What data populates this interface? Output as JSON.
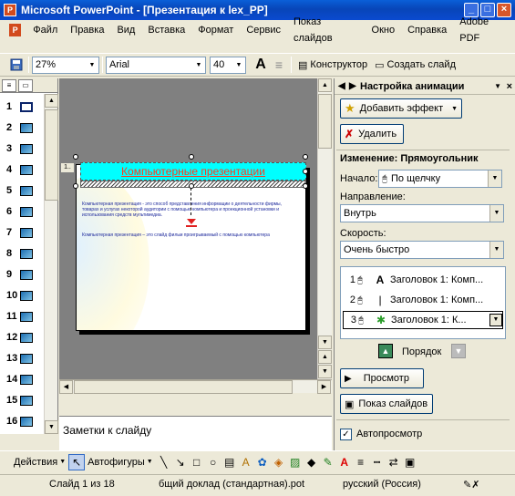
{
  "window": {
    "title": "Microsoft PowerPoint - [Презентация к lex_PP]",
    "app_icon": "powerpoint-icon",
    "controls": [
      "_",
      "□",
      "×"
    ]
  },
  "menubar": {
    "items": [
      "Файл",
      "Правка",
      "Вид",
      "Вставка",
      "Формат",
      "Сервис",
      "Показ слайдов",
      "Окно",
      "Справка",
      "Adobe PDF"
    ]
  },
  "toolbar": {
    "zoom": "27%",
    "font": "Arial",
    "font_size": "40",
    "designer_label": "Конструктор",
    "create_slide_label": "Создать слайд"
  },
  "thumbnails": {
    "numbers": [
      "1",
      "2",
      "3",
      "4",
      "5",
      "6",
      "7",
      "8",
      "9",
      "10",
      "11",
      "12",
      "13",
      "14",
      "15",
      "16"
    ],
    "selected": 1
  },
  "slide": {
    "title": "Компьютерные презентации",
    "paragraph1": "Компьютерная презентация - это способ представления информации о деятельности фирмы, товарах и услугах некоторой аудитории с помощью компьютера и проекционной установки и использования средств мультимедиа.",
    "paragraph2": "Компьютерная презентация – это слайд фильм проигрываемый с помощью компьютера"
  },
  "notes": {
    "placeholder": "Заметки к слайду"
  },
  "task_pane": {
    "title": "Настройка анимации",
    "add_effect": "Добавить эффект",
    "remove": "Удалить",
    "change_heading": "Изменение: Прямоугольник",
    "start_label": "Начало:",
    "start_value": "По щелчку",
    "direction_label": "Направление:",
    "direction_value": "Внутрь",
    "speed_label": "Скорость:",
    "speed_value": "Очень быстро",
    "animations": [
      {
        "num": "1",
        "text": "Заголовок 1: Комп..."
      },
      {
        "num": "2",
        "text": "Заголовок 1: Комп..."
      },
      {
        "num": "3",
        "text": "Заголовок 1: К..."
      }
    ],
    "order_label": "Порядок",
    "preview": "Просмотр",
    "slideshow": "Показ слайдов",
    "autopreview": "Автопросмотр",
    "autopreview_checked": true
  },
  "drawbar": {
    "actions": "Действия",
    "autoshapes": "Автофигуры"
  },
  "statusbar": {
    "slide": "Слайд 1 из 18",
    "template": "бщий доклад (стандартная).pot",
    "language": "русский (Россия)"
  },
  "colors": {
    "title_bar": "#0a4ad0",
    "slide_title": "#ff3c1e",
    "title_box_fill": "#00ffff",
    "slide_text": "#1e2a9c"
  }
}
